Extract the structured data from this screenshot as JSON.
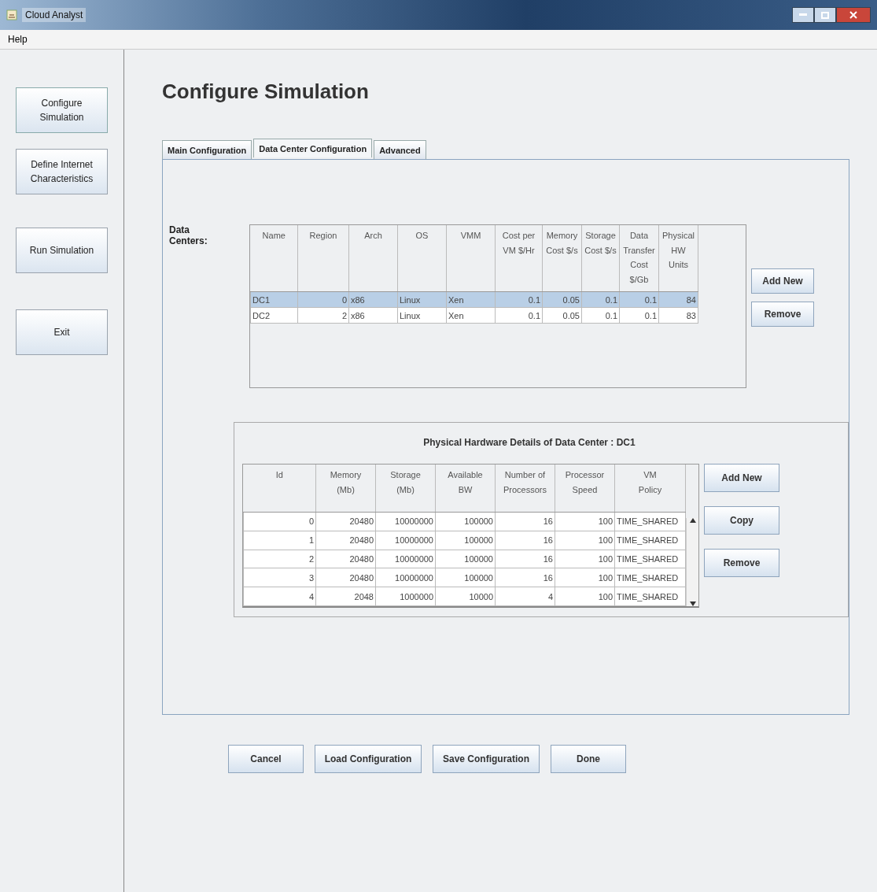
{
  "window": {
    "title": "Cloud Analyst"
  },
  "menu": [
    "Help"
  ],
  "sidebar": {
    "items": [
      {
        "label": "Configure\nSimulation",
        "selected": true
      },
      {
        "label": "Define Internet\nCharacteristics",
        "selected": false
      },
      {
        "label": "Run Simulation",
        "selected": false
      },
      {
        "label": "Exit",
        "selected": false
      }
    ]
  },
  "heading": "Configure Simulation",
  "tabs": [
    {
      "label": "Main Configuration",
      "selected": false
    },
    {
      "label": "Data Center Configuration",
      "selected": true
    },
    {
      "label": "Advanced",
      "selected": false
    }
  ],
  "data_centers": {
    "label": "Data\nCenters:",
    "columns": [
      "Name",
      "Region",
      "Arch",
      "OS",
      "VMM",
      "Cost per\nVM $/Hr",
      "Memory\nCost $/s",
      "Storage\nCost $/s",
      "Data\nTransfer\nCost $/Gb",
      "Physical\nHW\nUnits"
    ],
    "rows": [
      {
        "cells": [
          "DC1",
          "0",
          "x86",
          "Linux",
          "Xen",
          "0.1",
          "0.05",
          "0.1",
          "0.1",
          "84"
        ],
        "selected": true
      },
      {
        "cells": [
          "DC2",
          "2",
          "x86",
          "Linux",
          "Xen",
          "0.1",
          "0.05",
          "0.1",
          "0.1",
          "83"
        ],
        "selected": false
      }
    ],
    "buttons": [
      "Add New",
      "Remove"
    ]
  },
  "hardware": {
    "title": "Physical Hardware Details of Data Center : DC1",
    "columns": [
      "Id",
      "Memory\n(Mb)",
      "Storage\n(Mb)",
      "Available\nBW",
      "Number of\nProcessors",
      "Processor\nSpeed",
      "VM\nPolicy"
    ],
    "rows": [
      {
        "cells": [
          "0",
          "20480",
          "10000000",
          "100000",
          "16",
          "100",
          "TIME_SHARED"
        ]
      },
      {
        "cells": [
          "1",
          "20480",
          "10000000",
          "100000",
          "16",
          "100",
          "TIME_SHARED"
        ]
      },
      {
        "cells": [
          "2",
          "20480",
          "10000000",
          "100000",
          "16",
          "100",
          "TIME_SHARED"
        ]
      },
      {
        "cells": [
          "3",
          "20480",
          "10000000",
          "100000",
          "16",
          "100",
          "TIME_SHARED"
        ]
      },
      {
        "cells": [
          "4",
          "2048",
          "1000000",
          "10000",
          "4",
          "100",
          "TIME_SHARED"
        ]
      }
    ],
    "buttons": [
      "Add New",
      "Copy",
      "Remove"
    ]
  },
  "footer_buttons": [
    "Cancel",
    "Load Configuration",
    "Save Configuration",
    "Done"
  ]
}
